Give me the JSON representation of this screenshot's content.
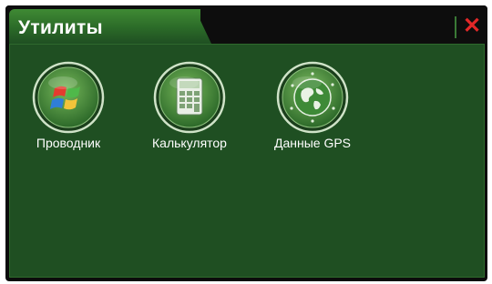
{
  "window": {
    "title": "Утилиты",
    "close_glyph": "✕"
  },
  "apps": [
    {
      "label": "Проводник",
      "icon": "windows-flag-icon"
    },
    {
      "label": "Калькулятор",
      "icon": "calculator-icon"
    },
    {
      "label": "Данные GPS",
      "icon": "globe-icon"
    }
  ],
  "colors": {
    "panel_bg": "#1f4f22",
    "tab_green": "#2b6a28",
    "frame_black": "#0b0b0b",
    "close_red": "#e32828"
  }
}
